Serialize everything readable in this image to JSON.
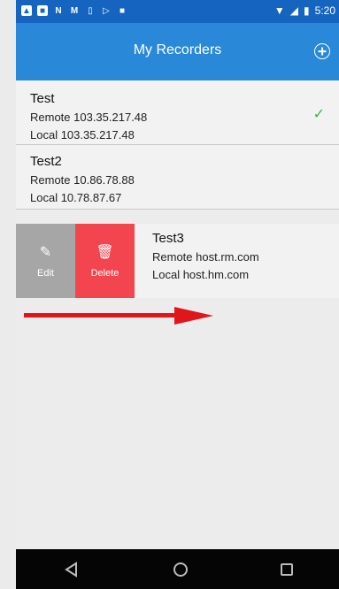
{
  "status_bar": {
    "icons": [
      "gallery-icon",
      "n-letter-icon",
      "n-letter-icon",
      "m-icon",
      "storage-icon",
      "play-icon",
      "video-icon"
    ],
    "right_icons": [
      "wifi-icon",
      "signal-icon",
      "battery-icon"
    ],
    "time": "5:20"
  },
  "app_bar": {
    "title": "My Recorders",
    "add_icon": "plus-circle-icon"
  },
  "recorders": [
    {
      "name": "Test",
      "remote": "Remote 103.35.217.48",
      "local": "Local 103.35.217.48",
      "status_icon": "check-icon"
    },
    {
      "name": "Test2",
      "remote": "Remote 10.86.78.88",
      "local": "Local 10.78.87.67"
    },
    {
      "name": "Test3",
      "remote": "Remote host.rm.com",
      "local": "Local host.hm.com"
    }
  ],
  "swipe_actions": {
    "edit": {
      "label": "Edit",
      "icon": "pencil-icon",
      "color": "#a6a6a6"
    },
    "delete": {
      "label": "Delete",
      "icon": "trash-icon",
      "color": "#f3454f"
    }
  },
  "annotation": {
    "arrow_color": "#e0161b",
    "arrow_direction": "right"
  },
  "nav_bar": {
    "buttons": [
      "back-icon",
      "home-icon",
      "recents-icon"
    ]
  },
  "colors": {
    "status_bar": "#1565c0",
    "app_bar": "#2a88d8",
    "check": "#3db24a"
  }
}
